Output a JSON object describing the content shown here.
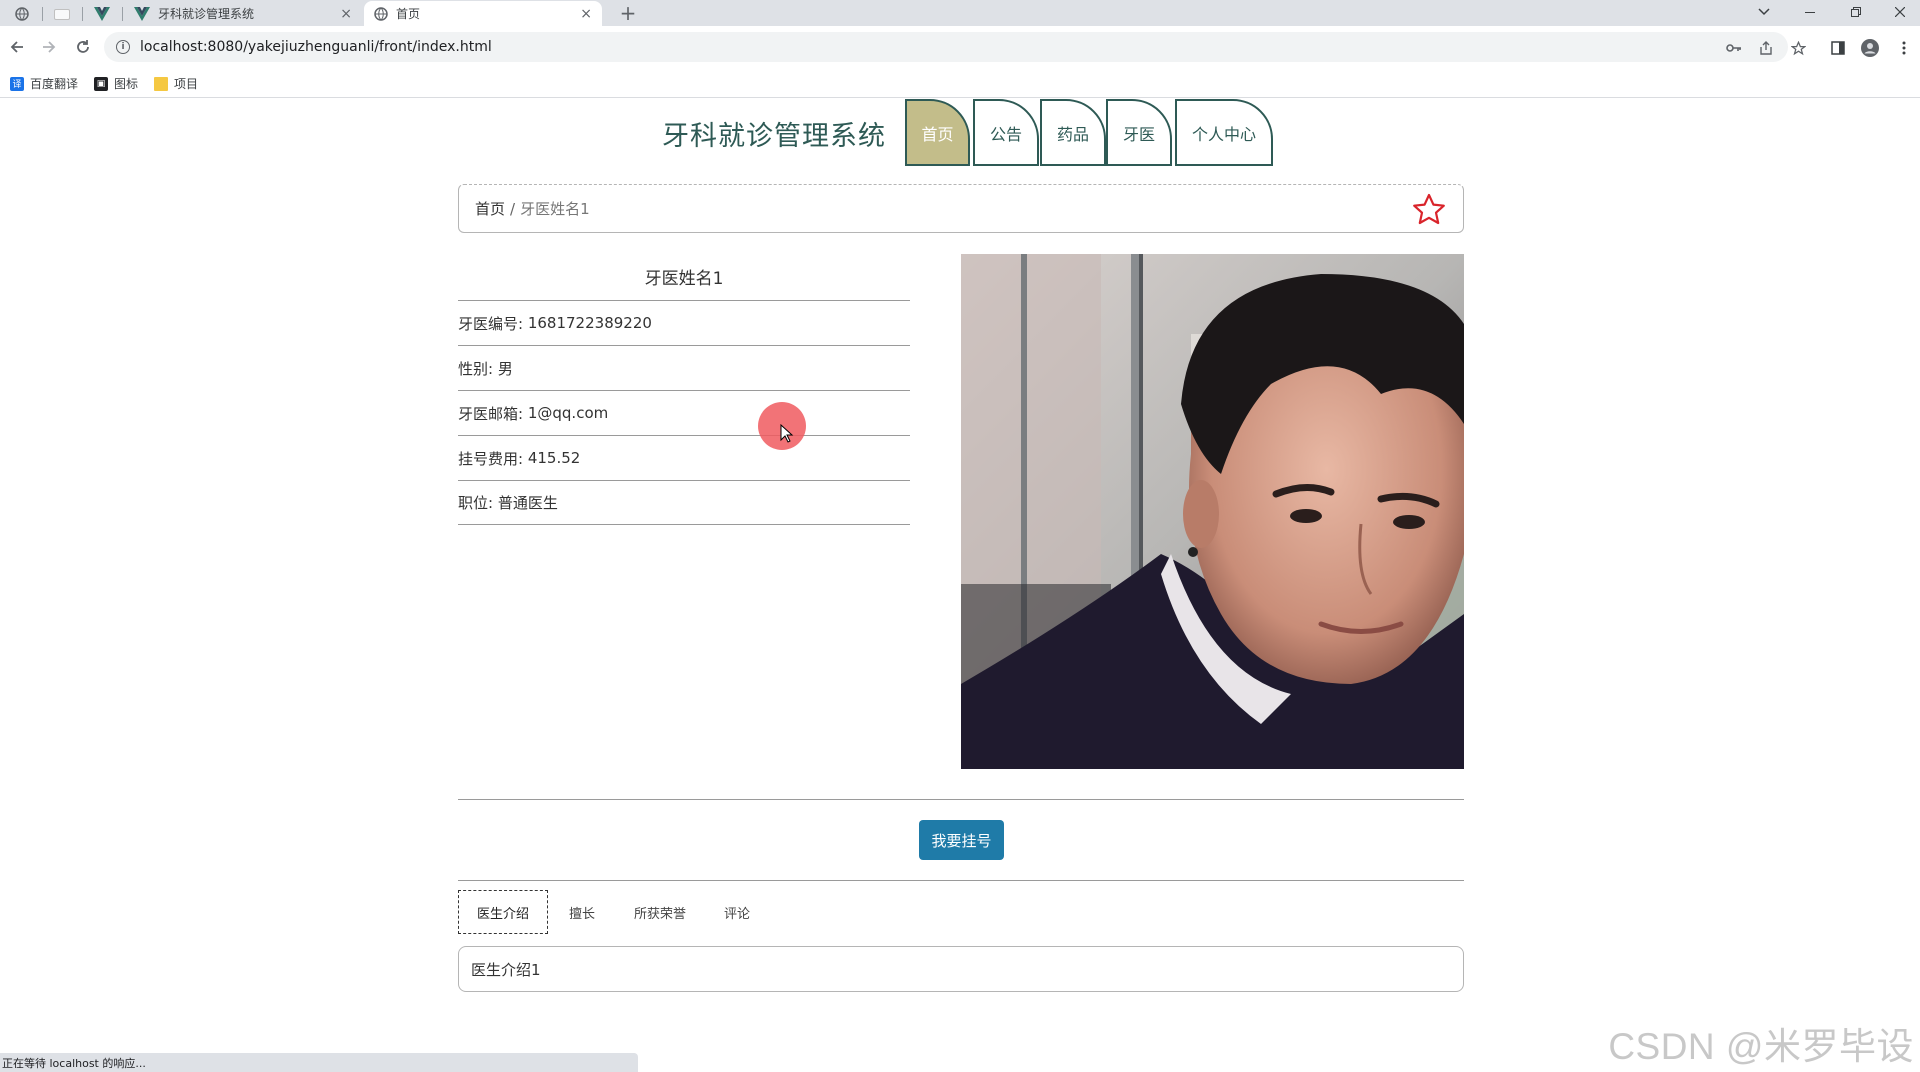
{
  "browser": {
    "tabs": [
      {
        "title": "牙科就诊管理系统",
        "favicon": "vue-icon",
        "active": false
      },
      {
        "title": "首页",
        "favicon": "globe-icon",
        "active": true
      }
    ],
    "close_glyph": "×",
    "new_tab_glyph": "+",
    "url": "localhost:8080/yakejiuzhenguanli/front/index.html",
    "bookmarks": [
      {
        "label": "百度翻译",
        "icon": "translate-icon",
        "color": "#1a73e8"
      },
      {
        "label": "图标",
        "icon": "image-icon",
        "color": "#202124"
      },
      {
        "label": "项目",
        "icon": "folder-icon",
        "color": "#f5c842"
      }
    ],
    "status_text": "正在等待 localhost 的响应..."
  },
  "site": {
    "title": "牙科就诊管理系统",
    "nav": [
      {
        "label": "首页",
        "active": true
      },
      {
        "label": "公告",
        "active": false
      },
      {
        "label": "药品",
        "active": false
      },
      {
        "label": "牙医",
        "active": false
      },
      {
        "label": "个人中心",
        "active": false
      }
    ]
  },
  "breadcrumb": {
    "home": "首页",
    "separator": "/",
    "current": "牙医姓名1"
  },
  "doctor": {
    "name": "牙医姓名1",
    "fields": [
      {
        "label": "牙医编号:",
        "value": "1681722389220"
      },
      {
        "label": "性别:",
        "value": "男"
      },
      {
        "label": "牙医邮箱:",
        "value": "1@qq.com"
      },
      {
        "label": "挂号费用:",
        "value": "415.52"
      },
      {
        "label": "职位:",
        "value": "普通医生"
      }
    ]
  },
  "actions": {
    "book_label": "我要挂号"
  },
  "detail_tabs": [
    {
      "label": "医生介绍",
      "active": true
    },
    {
      "label": "擅长",
      "active": false
    },
    {
      "label": "所获荣誉",
      "active": false
    },
    {
      "label": "评论",
      "active": false
    }
  ],
  "detail_content": "医生介绍1",
  "watermark": "CSDN @米罗毕设",
  "colors": {
    "brand": "#2e5a55",
    "nav_active": "#c3bd8a",
    "button": "#1f7ba8",
    "star": "#d9242b"
  }
}
